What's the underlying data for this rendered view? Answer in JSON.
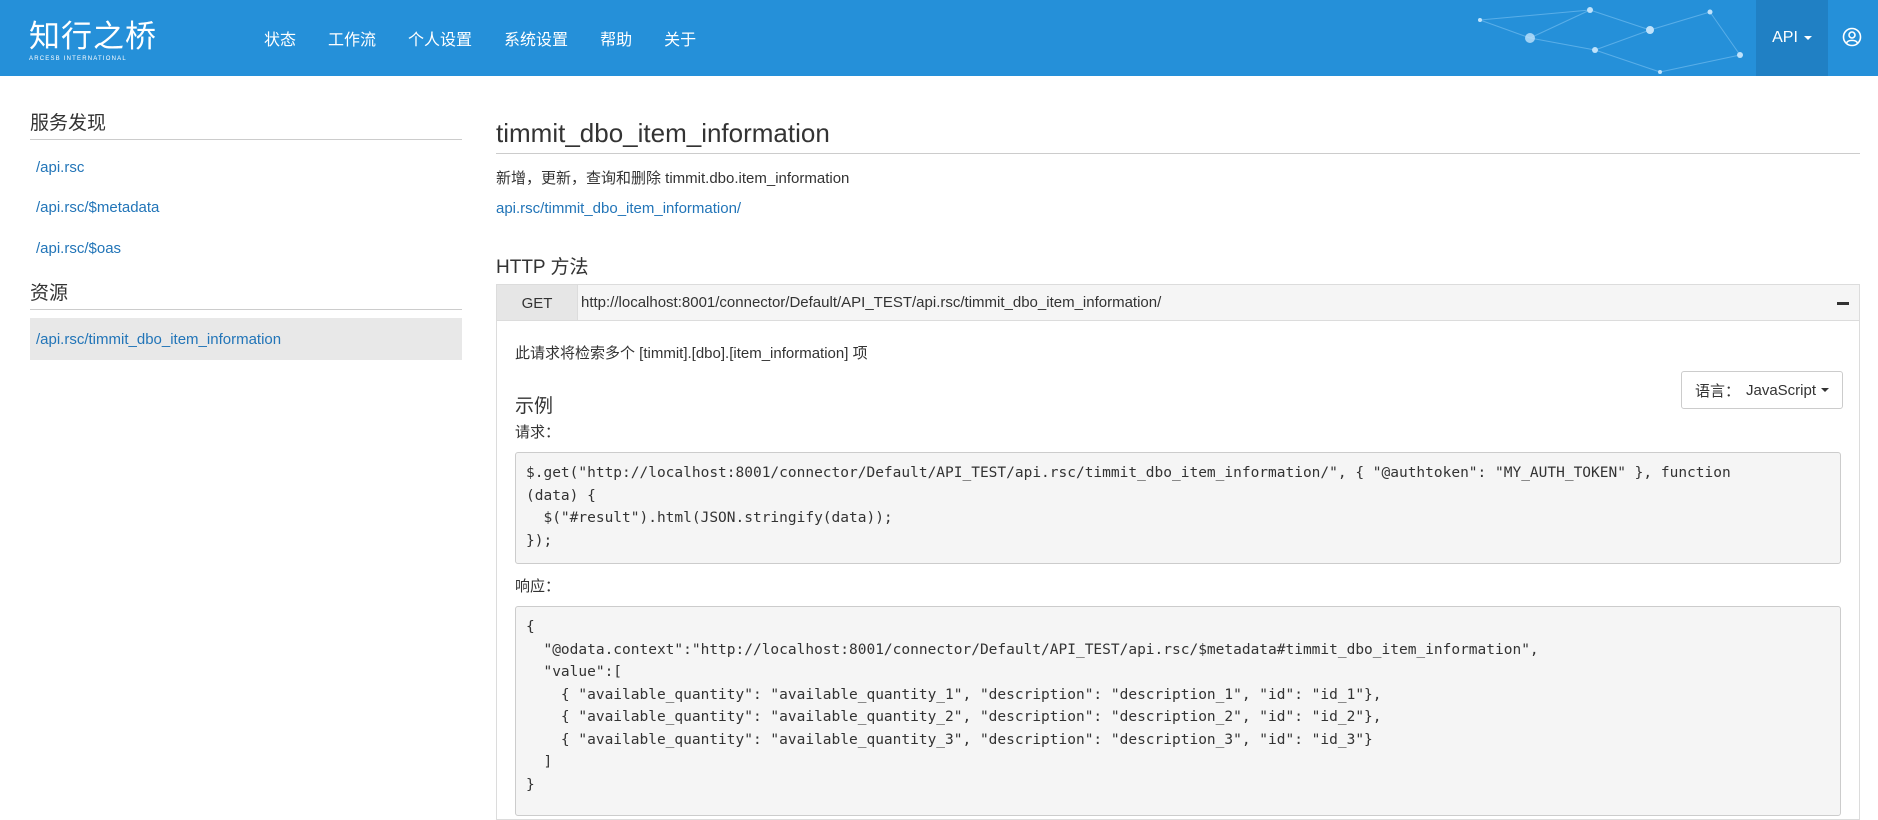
{
  "header": {
    "logo_cn": "知行之桥",
    "logo_en": "ARCESB INTERNATIONAL",
    "nav": [
      "状态",
      "工作流",
      "个人设置",
      "系统设置",
      "帮助",
      "关于"
    ],
    "api_menu": "API",
    "user_icon": "user-circle-icon",
    "brand_color": "#2590d9"
  },
  "sidebar": {
    "discovery_heading": "服务发现",
    "discovery_links": [
      "/api.rsc",
      "/api.rsc/$metadata",
      "/api.rsc/$oas"
    ],
    "resources_heading": "资源",
    "resources": [
      "/api.rsc/timmit_dbo_item_information"
    ]
  },
  "main": {
    "title": "timmit_dbo_item_information",
    "description": "新增，更新，查询和删除 timmit.dbo.item_information",
    "resource_link": "api.rsc/timmit_dbo_item_information/",
    "http_heading": "HTTP 方法",
    "method": {
      "verb": "GET",
      "url": "http://localhost:8001/connector/Default/API_TEST/api.rsc/timmit_dbo_item_information/",
      "request_desc": "此请求将检索多个 [timmit].[dbo].[item_information] 项",
      "example_heading": "示例",
      "language_label": "语言：",
      "language_value": "JavaScript",
      "request_label": "请求：",
      "request_code": "$.get(\"http://localhost:8001/connector/Default/API_TEST/api.rsc/timmit_dbo_item_information/\", { \"@authtoken\": \"MY_AUTH_TOKEN\" }, function\n(data) {\n  $(\"#result\").html(JSON.stringify(data));\n});",
      "response_label": "响应：",
      "response_code": "{\n  \"@odata.context\":\"http://localhost:8001/connector/Default/API_TEST/api.rsc/$metadata#timmit_dbo_item_information\",\n  \"value\":[\n    { \"available_quantity\": \"available_quantity_1\", \"description\": \"description_1\", \"id\": \"id_1\"},\n    { \"available_quantity\": \"available_quantity_2\", \"description\": \"description_2\", \"id\": \"id_2\"},\n    { \"available_quantity\": \"available_quantity_3\", \"description\": \"description_3\", \"id\": \"id_3\"}\n  ]\n}"
    }
  }
}
